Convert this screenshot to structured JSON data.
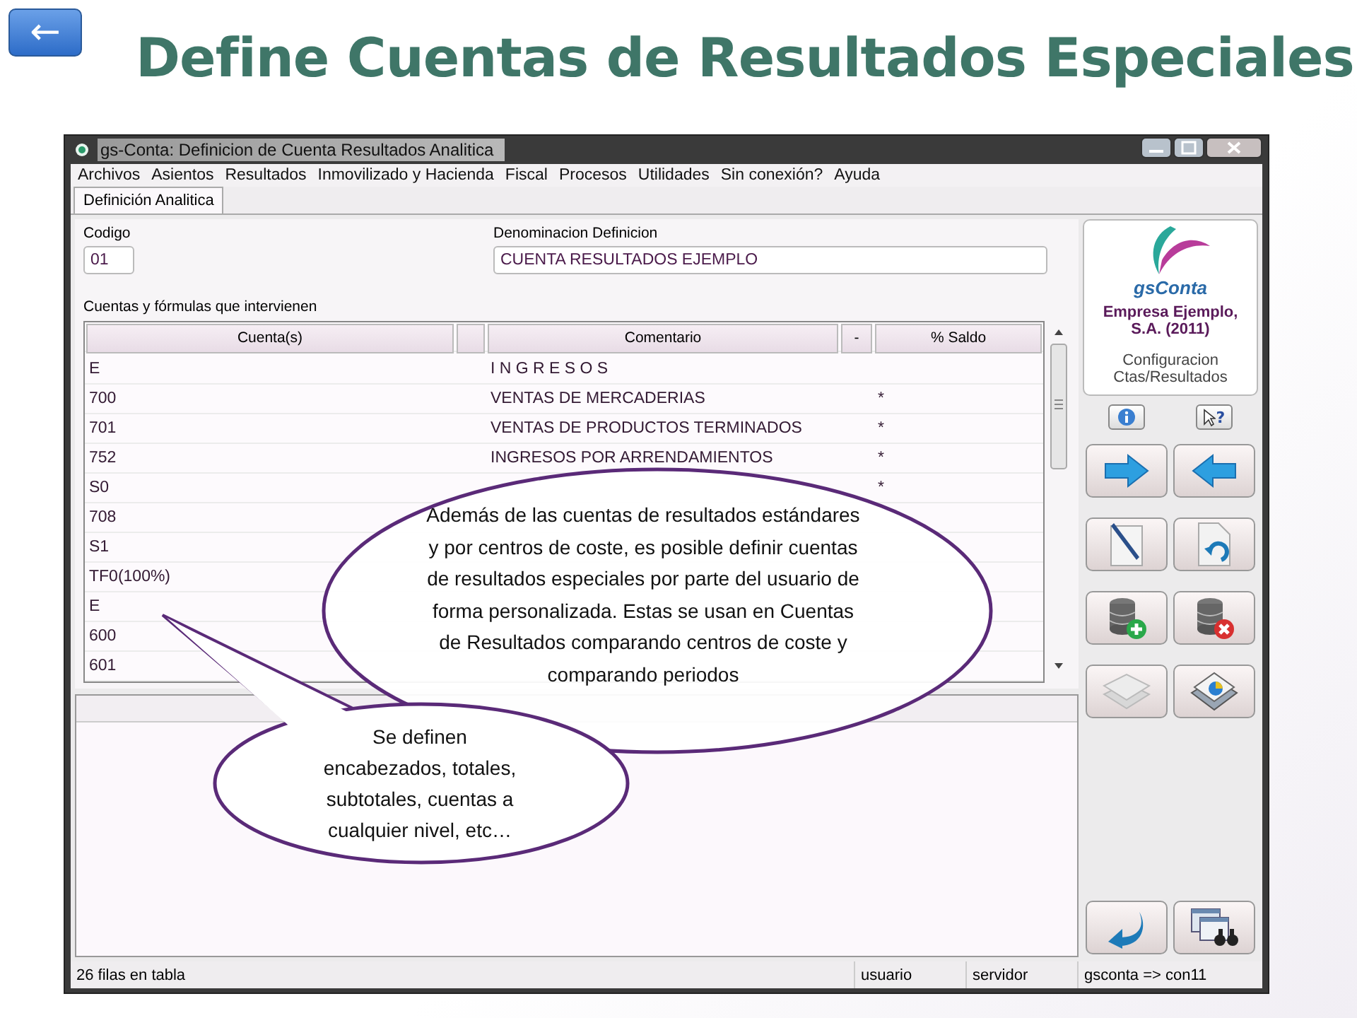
{
  "slide": {
    "back_button": "←",
    "title": "Define Cuentas de Resultados Especiales"
  },
  "window": {
    "title": "gs-Conta: Definicion de Cuenta Resultados Analitica"
  },
  "menu": [
    "Archivos",
    "Asientos",
    "Resultados",
    "Inmovilizado y Hacienda",
    "Fiscal",
    "Procesos",
    "Utilidades",
    "Sin conexión?",
    "Ayuda"
  ],
  "tabs": [
    {
      "label": "Definición Analitica",
      "selected": true
    }
  ],
  "form": {
    "codigo": {
      "label": "Codigo",
      "value": "01"
    },
    "denominacion": {
      "label": "Denominacion Definicion",
      "value": "CUENTA RESULTADOS EJEMPLO"
    }
  },
  "table": {
    "caption": "Cuentas y fórmulas que intervienen",
    "columns": [
      {
        "label": "Cuenta(s)"
      },
      {
        "label": "Comentario"
      },
      {
        "label": "-"
      },
      {
        "label": "% Saldo"
      }
    ],
    "rows": [
      {
        "cuenta": "E",
        "comentario": "I N G R E S O S"
      },
      {
        "cuenta": "700",
        "comentario": "VENTAS DE MERCADERIAS",
        "saldo": "*"
      },
      {
        "cuenta": "701",
        "comentario": "VENTAS DE PRODUCTOS TERMINADOS",
        "saldo": "*"
      },
      {
        "cuenta": "752",
        "comentario": "INGRESOS POR ARRENDAMIENTOS",
        "saldo": "*"
      },
      {
        "cuenta": "S0",
        "saldo": "*"
      },
      {
        "cuenta": "708"
      },
      {
        "cuenta": "S1"
      },
      {
        "cuenta": "TF0(100%)"
      },
      {
        "cuenta": "E"
      },
      {
        "cuenta": "600"
      },
      {
        "cuenta": "601"
      }
    ]
  },
  "side_panel": {
    "help_button": "?",
    "brand": "gsConta",
    "company": "Empresa Ejemplo, S.A. (2011)",
    "module": "Configuracion Ctas/Resultados"
  },
  "status_bar": [
    "26 filas en tabla",
    "usuario",
    "servidor",
    "gsconta => con11"
  ],
  "callouts": [
    {
      "text": "Además de las cuentas de resultados estándares y por centros de coste, es posible definir cuentas de resultados especiales por parte del usuario de forma personalizada. Estas se usan en Cuentas de Resultados comparando centros de coste y comparando periodos"
    },
    {
      "text": "Se definen encabezados, totales, subtotales, cuentas a cualquier nivel, etc…"
    }
  ]
}
